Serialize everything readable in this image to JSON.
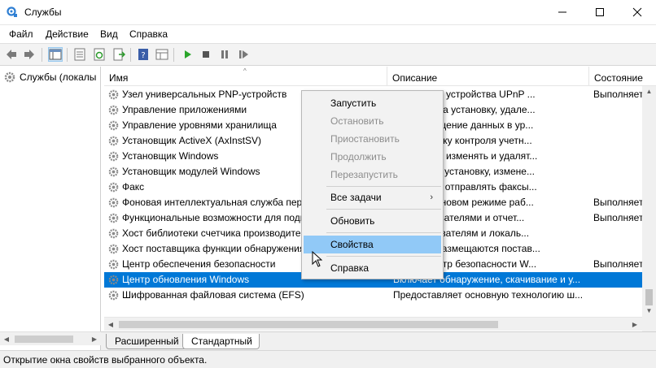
{
  "window": {
    "title": "Службы",
    "buttons": {
      "minimize": "minimize-icon",
      "maximize": "maximize-icon",
      "close": "close-icon"
    }
  },
  "menubar": [
    "Файл",
    "Действие",
    "Вид",
    "Справка"
  ],
  "toolbar": {
    "icons": [
      "back-arrow-icon",
      "forward-arrow-icon",
      "show-hide-console-tree-icon",
      "properties-icon",
      "refresh-icon",
      "export-list-icon",
      "help-icon",
      "show-extended-icon",
      "start-service-icon",
      "stop-service-icon",
      "pause-service-icon",
      "restart-service-icon"
    ]
  },
  "tree": {
    "item": "Службы (локалы"
  },
  "columns": {
    "name": "Имя",
    "description": "Описание",
    "state": "Состояние"
  },
  "rows": [
    {
      "name": "Узел универсальных PNP-устройств",
      "description": "размещать устройства UPnP ...",
      "state": "Выполняется"
    },
    {
      "name": "Управление приложениями",
      "description": "запросов на установку, удале...",
      "state": ""
    },
    {
      "name": "Управление уровнями хранилища",
      "description": "ает размещение данных в ур...",
      "state": ""
    },
    {
      "name": "Установщик ActiveX (AxInstSV)",
      "description": "ает проверку контроля учетн...",
      "state": ""
    },
    {
      "name": "Установщик Windows",
      "description": "добавлять, изменять и удалят...",
      "state": ""
    },
    {
      "name": "Установщик модулей Windows",
      "description": "выполнять установку, измене...",
      "state": ""
    },
    {
      "name": "Факс",
      "description": "получать и отправлять факсы...",
      "state": ""
    },
    {
      "name": "Фоновая интеллектуальная служба пере",
      "description": "айлы в фоновом режиме раб...",
      "state": "Выполняется"
    },
    {
      "name": "Функциональные возможности для подк",
      "description": "ми пользователями и отчет...",
      "state": "Выполняется"
    },
    {
      "name": "Хост библиотеки счетчика производите",
      "description": "ым пользователям и локаль...",
      "state": ""
    },
    {
      "name": "Хост поставщика функции обнаружения",
      "description": "DPHOST размещаются постав...",
      "state": ""
    },
    {
      "name": "Центр обеспечения безопасности",
      "description": "CSVC (центр безопасности W...",
      "state": "Выполняется"
    },
    {
      "name": "Центр обновления Windows",
      "description": "Включает обнаружение, скачивание и у...",
      "state": ""
    },
    {
      "name": "Шифрованная файловая система (EFS)",
      "description": "Предоставляет основную технологию ш...",
      "state": ""
    }
  ],
  "selected_row_index": 12,
  "context_menu": {
    "start": "Запустить",
    "stop": "Остановить",
    "pause": "Приостановить",
    "resume": "Продолжить",
    "restart": "Перезапустить",
    "all_tasks": "Все задачи",
    "refresh": "Обновить",
    "properties": "Свойства",
    "help": "Справка"
  },
  "tabs": {
    "extended": "Расширенный",
    "standard": "Стандартный"
  },
  "status": "Открытие окна свойств выбранного объекта.",
  "colors": {
    "selection": "#0078d7",
    "menu_hover": "#91c9f7"
  }
}
